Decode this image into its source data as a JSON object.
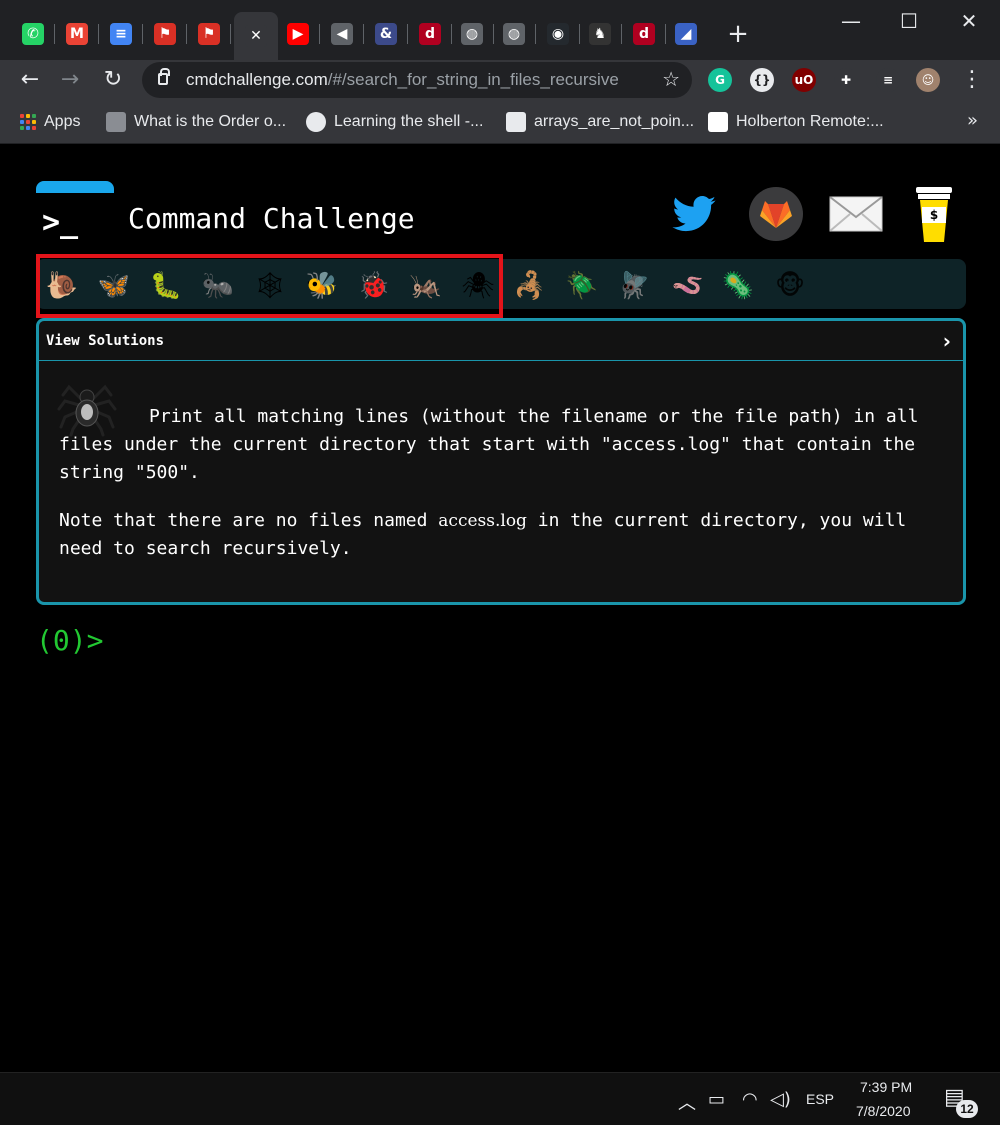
{
  "browser": {
    "tabs": [
      {
        "icon": "whatsapp-icon",
        "glyph": "✆",
        "color": "#25d366"
      },
      {
        "icon": "gmail-icon",
        "glyph": "M",
        "color": "#ea4335"
      },
      {
        "icon": "google-docs-icon",
        "glyph": "≡",
        "color": "#4285f4"
      },
      {
        "icon": "red-tool-icon",
        "glyph": "⚑",
        "color": "#d93025"
      },
      {
        "icon": "red-tool-icon",
        "glyph": "⚑",
        "color": "#d93025"
      },
      {
        "icon": "close-tab-icon",
        "glyph": "✕",
        "color": "#35363a"
      },
      {
        "icon": "youtube-icon",
        "glyph": "▶",
        "color": "#ff0000"
      },
      {
        "icon": "speaker-icon",
        "glyph": "◀",
        "color": "#5f6368"
      },
      {
        "icon": "ampersand-icon",
        "glyph": "&",
        "color": "#3c4a8a"
      },
      {
        "icon": "dev-icon",
        "glyph": "d",
        "color": "#b00020"
      },
      {
        "icon": "globe-icon",
        "glyph": "◍",
        "color": "#5f6368"
      },
      {
        "icon": "globe-icon",
        "glyph": "◍",
        "color": "#5f6368"
      },
      {
        "icon": "github-icon",
        "glyph": "◉",
        "color": "#24292e"
      },
      {
        "icon": "bird-icon",
        "glyph": "♞",
        "color": "#333333"
      },
      {
        "icon": "dev-icon",
        "glyph": "d",
        "color": "#b00020"
      },
      {
        "icon": "app-icon",
        "glyph": "◢",
        "color": "#3a62c4"
      }
    ],
    "new_tab": "+",
    "window_controls": {
      "minimize": "—",
      "maximize": "☐",
      "close": "✕"
    },
    "nav": {
      "back": "←",
      "forward": "→",
      "reload": "↻"
    },
    "address": {
      "host": "cmdchallenge.com",
      "path": "/#/search_for_string_in_files_recursive"
    },
    "star": "☆",
    "extensions": [
      {
        "icon": "grammarly-icon",
        "glyph": "G",
        "color": "#15c39a"
      },
      {
        "icon": "json-viewer-icon",
        "glyph": "{}",
        "color": "#e8eaed"
      },
      {
        "icon": "ublock-icon",
        "glyph": "uO",
        "color": "#800000"
      },
      {
        "icon": "extensions-puzzle-icon",
        "glyph": "✚",
        "color": "#35363a"
      },
      {
        "icon": "reading-list-icon",
        "glyph": "≡",
        "color": "#35363a"
      },
      {
        "icon": "profile-avatar-icon",
        "glyph": "☺",
        "color": "#a0826d"
      }
    ],
    "menu": "⋮",
    "bookmarks": [
      {
        "label": "Apps",
        "icon": "apps-grid-icon"
      },
      {
        "label": "What is the Order o...",
        "icon": "page-icon",
        "color": "#8a8d93"
      },
      {
        "label": "Learning the shell -...",
        "icon": "globe-icon",
        "color": "#e8eaed"
      },
      {
        "label": "arrays_are_not_poin...",
        "icon": "site-icon",
        "color": "#e8eaed"
      },
      {
        "label": "Holberton Remote:...",
        "icon": "notion-icon",
        "color": "#ffffff"
      }
    ],
    "bookmarks_more": "»"
  },
  "page": {
    "title": "Command Challenge",
    "logo_prompt": ">_",
    "social": [
      "twitter-icon",
      "gitlab-icon",
      "mail-icon",
      "coffee-donate-icon"
    ],
    "challenges": [
      {
        "icon": "snail-icon",
        "glyph": "🐌"
      },
      {
        "icon": "butterfly-icon",
        "glyph": "🦋"
      },
      {
        "icon": "caterpillar-icon",
        "glyph": "🐛"
      },
      {
        "icon": "ant-icon",
        "glyph": "🐜"
      },
      {
        "icon": "web-icon",
        "glyph": "🕸"
      },
      {
        "icon": "bee-icon",
        "glyph": "🐝"
      },
      {
        "icon": "ladybug-icon",
        "glyph": "🐞"
      },
      {
        "icon": "cricket-icon",
        "glyph": "🦗"
      },
      {
        "icon": "spider-icon",
        "glyph": "🕷"
      },
      {
        "icon": "scorpion-icon",
        "glyph": "🦂"
      },
      {
        "icon": "beetle-icon",
        "glyph": "🪲"
      },
      {
        "icon": "fly-icon",
        "glyph": "🪰"
      },
      {
        "icon": "worm-icon",
        "glyph": "🪱"
      },
      {
        "icon": "microbe-icon",
        "glyph": "🦠"
      },
      {
        "icon": "monkey-icon",
        "glyph": "🐵"
      }
    ],
    "card": {
      "header": "View Solutions",
      "chevron": "›",
      "description": "Print all matching lines (without the filename or the file path) in all files under the current directory that start with \"access.log\" that contain the string \"500\".",
      "note_before": "Note that there are no files named ",
      "note_code": "access.log",
      "note_after": " in the current directory, you will need to search recursively."
    },
    "prompt": "(0)>"
  },
  "taskbar": {
    "language": "ESP",
    "time": "7:39 PM",
    "date": "7/8/2020",
    "notifications": "12"
  }
}
